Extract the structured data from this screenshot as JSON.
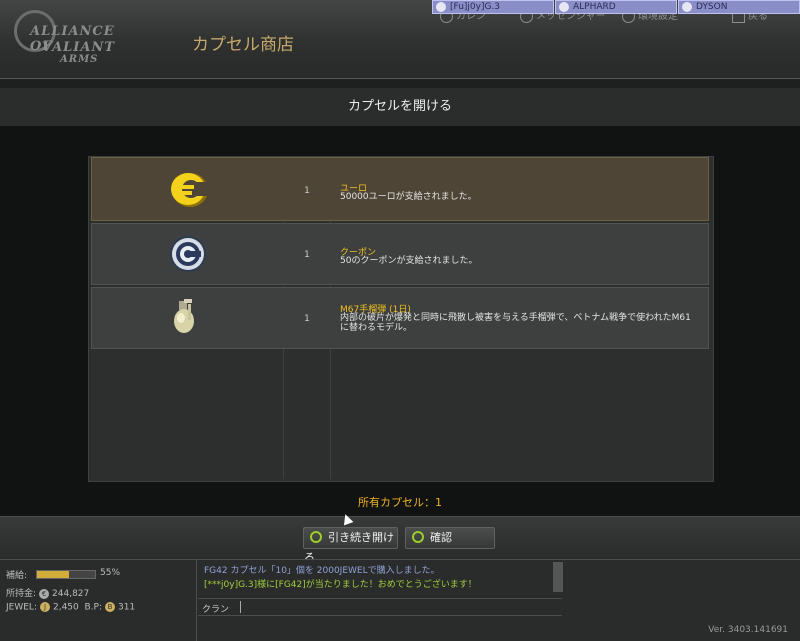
{
  "header": {
    "store_title": "カプセル商店",
    "logo_text": [
      "ALLIANCE OF",
      "VALIANT",
      "ARMS"
    ],
    "nav": [
      {
        "label": "カレン",
        "icon": "home-icon"
      },
      {
        "label": "メッセンジャー",
        "icon": "messenger-icon"
      },
      {
        "label": "環境設定",
        "icon": "settings-icon"
      },
      {
        "label": "戻る",
        "icon": "back-icon"
      }
    ],
    "players": [
      "[Fu]j0y]G.3",
      "ALPHARD",
      "DYSON"
    ]
  },
  "dialog": {
    "title": "カプセルを開ける",
    "items": [
      {
        "icon": "euro-icon",
        "qty": "1",
        "name": "ユーロ",
        "desc": "50000ユーロが支給されました。"
      },
      {
        "icon": "coupon-icon",
        "qty": "1",
        "name": "クーポン",
        "desc": "50のクーポンが支給されました。"
      },
      {
        "icon": "grenade-icon",
        "qty": "1",
        "name": "M67手榴弾 (1日)",
        "desc": "内部の破片が爆発と同時に飛散し被害を与える手榴弾で、ベトナム戦争で使われたM61に替わるモデル。"
      }
    ],
    "owned_label": "所有カプセル：1"
  },
  "actions": {
    "continue_label": "引き続き開ける",
    "confirm_label": "確認"
  },
  "status": {
    "supply_label": "補給:",
    "supply_percent": 55,
    "supply_percent_text": "55%",
    "money_label": "所持金:",
    "money_value": "244,827",
    "jewel_label": "JEWEL:",
    "jewel_value": "2,450",
    "bp_label": "B.P:",
    "bp_value": "311"
  },
  "chat": {
    "lines": [
      {
        "text": "FG42 カプセル「10」個を 2000JEWELで購入しました。",
        "color": "#8fa0d8"
      },
      {
        "text": "[***j0y]G.3]様に[FG42]が当たりました！おめでとうございます！",
        "color": "#9fd03a"
      }
    ],
    "tab_label": "クラン"
  },
  "version": "Ver. 3403.141691",
  "colors": {
    "accent_gold": "#f0c020",
    "selected_row": "#4e4536",
    "green_ring": "#9ccd2a"
  }
}
